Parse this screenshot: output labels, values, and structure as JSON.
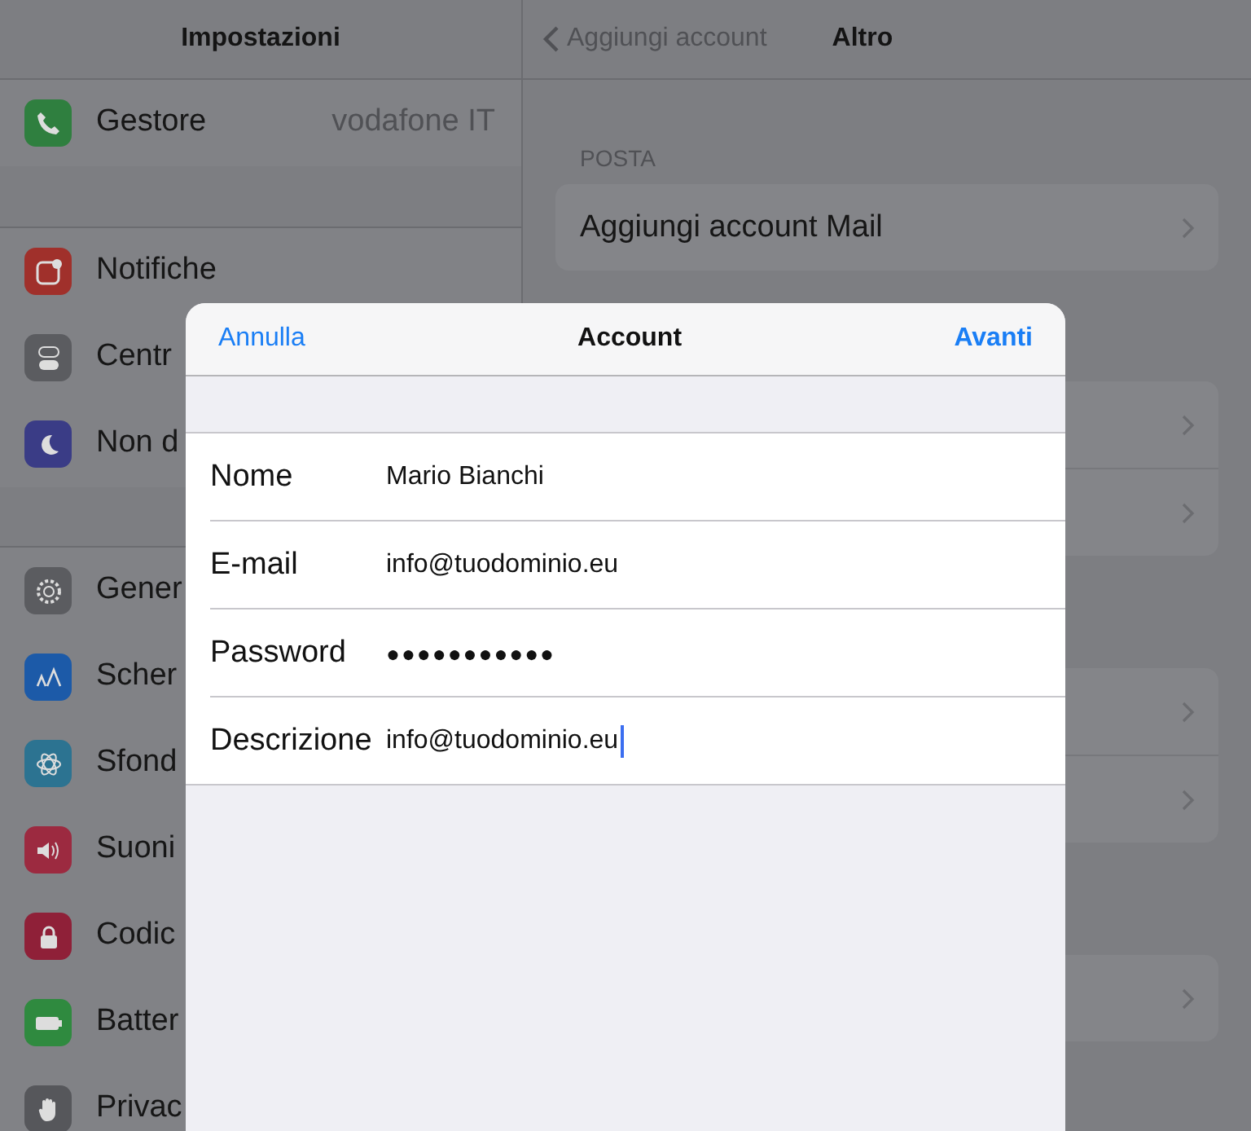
{
  "sidebar": {
    "title": "Impostazioni",
    "groups": [
      [
        {
          "color": "#2f7f3f",
          "label": "Gestore",
          "value": "vodafone IT"
        }
      ],
      [
        {
          "color": "#a0302b",
          "label": "Notifiche"
        },
        {
          "color": "#5b5c60",
          "label": "Centr"
        },
        {
          "color": "#3a3c86",
          "label": "Non d"
        }
      ],
      [
        {
          "color": "#5b5c60",
          "label": "Gener"
        },
        {
          "color": "#1c5aa8",
          "label": "Scher"
        },
        {
          "color": "#2c7391",
          "label": "Sfond"
        },
        {
          "color": "#9c2a40",
          "label": "Suoni"
        },
        {
          "color": "#8f2038",
          "label": "Codic"
        },
        {
          "color": "#2f8a3f",
          "label": "Batter"
        },
        {
          "color": "#56575b",
          "label": "Privac"
        }
      ]
    ]
  },
  "detail": {
    "back": "Aggiungi account",
    "title": "Altro",
    "section": "POSTA",
    "row": "Aggiungi account Mail"
  },
  "dialog": {
    "cancel": "Annulla",
    "title": "Account",
    "next": "Avanti",
    "fields": [
      {
        "label": "Nome",
        "value": "Mario Bianchi",
        "kind": "text"
      },
      {
        "label": "E-mail",
        "value": "info@tuodominio.eu",
        "kind": "text"
      },
      {
        "label": "Password",
        "value": "●●●●●●●●●●●",
        "kind": "password"
      },
      {
        "label": "Descrizione",
        "value": "info@tuodominio.eu",
        "kind": "text",
        "focused": true
      }
    ]
  }
}
